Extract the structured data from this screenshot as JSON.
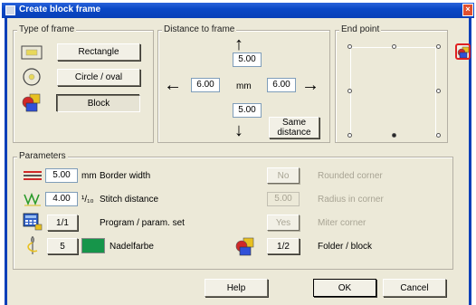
{
  "window": {
    "title": "Create block frame",
    "close_glyph": "×"
  },
  "type_of_frame": {
    "title": "Type of frame",
    "options": [
      {
        "label": "Rectangle",
        "icon": "rectangle-icon"
      },
      {
        "label": "Circle / oval",
        "icon": "circle-icon"
      },
      {
        "label": "Block",
        "icon": "block-shapes-icon",
        "selected": true
      }
    ]
  },
  "distance": {
    "title": "Distance to frame",
    "top": "5.00",
    "left": "6.00",
    "right": "6.00",
    "bottom": "5.00",
    "unit": "mm",
    "same_distance_label": "Same distance",
    "arrows": {
      "up": "↑",
      "down": "↓",
      "left": "←",
      "right": "→"
    }
  },
  "end_point": {
    "title": "End point",
    "selected_position": "bottom-center"
  },
  "parameters": {
    "title": "Parameters",
    "border_width": {
      "value": "5.00",
      "unit": "mm",
      "label": "Border width"
    },
    "stitch_distance": {
      "value": "4.00",
      "unit": "¹/₁₀",
      "label": "Stitch distance"
    },
    "program": {
      "value": "1/1",
      "label": "Program / param. set"
    },
    "needle_color": {
      "value": "5",
      "label": "Nadelfarbe",
      "swatch": "#16954a"
    },
    "rounded_corner": {
      "value": "No",
      "label": "Rounded corner"
    },
    "radius_in_corner": {
      "value": "5.00",
      "label": "Radius in corner"
    },
    "miter_corner": {
      "value": "Yes",
      "label": "Miter corner"
    },
    "folder_block": {
      "value": "1/2",
      "label": "Folder / block"
    }
  },
  "footer": {
    "help": "Help",
    "ok": "OK",
    "cancel": "Cancel"
  },
  "colors": {
    "title_bar": "#0a48c6",
    "dialog_bg": "#ece9d8",
    "accent_red": "#e02020",
    "swatch_green": "#16954a"
  }
}
